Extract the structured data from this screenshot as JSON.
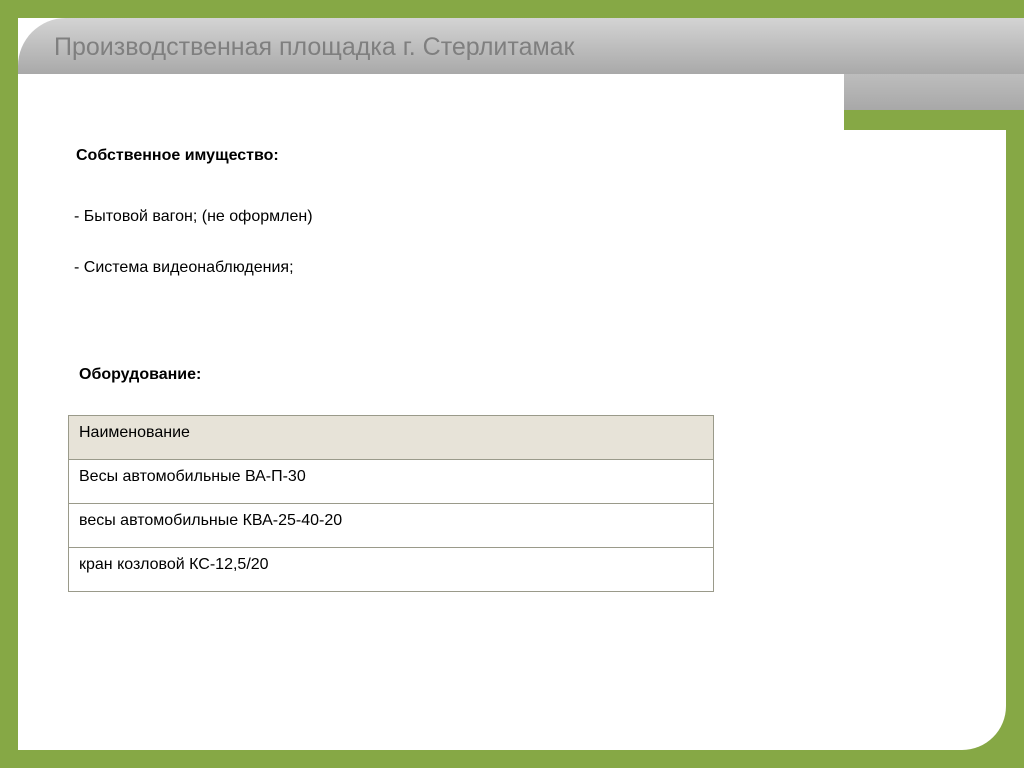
{
  "slide": {
    "title": "Производственная площадка г. Стерлитамак",
    "property_heading": "Собственное имущество:",
    "property_items": [
      "- Бытовой вагон; (не оформлен)",
      "- Система видеонаблюдения;"
    ],
    "equipment_heading": "Оборудование:",
    "table": {
      "header": "Наименование",
      "rows": [
        "Весы автомобильные ВА-П-30",
        "весы автомобильные КВА-25-40-20",
        "кран козловой КС-12,5/20"
      ]
    }
  },
  "colors": {
    "accent_green": "#86a845",
    "title_grey": "#7f7f7f",
    "table_header_bg": "#e7e3d8"
  }
}
